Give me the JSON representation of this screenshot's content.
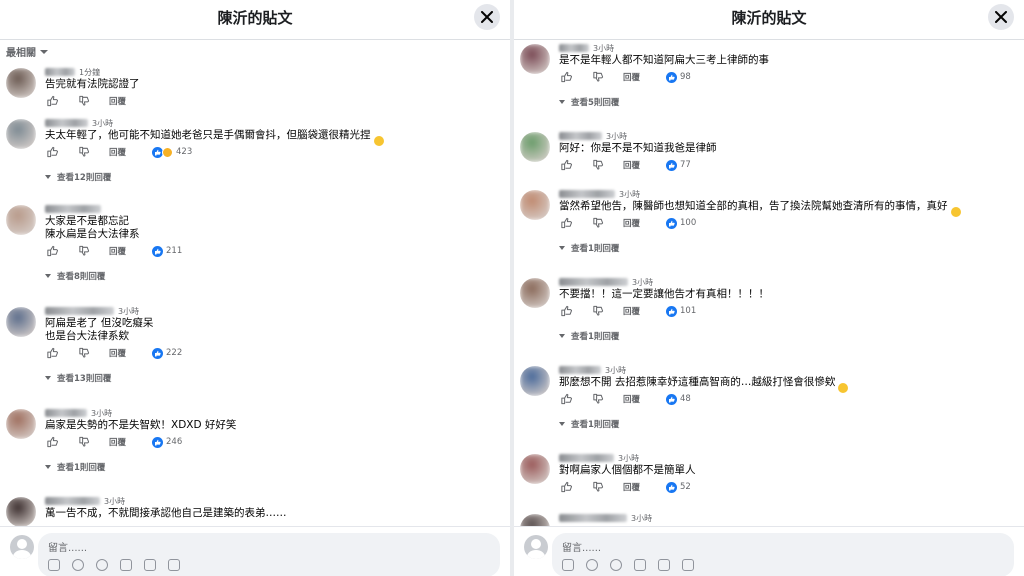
{
  "panels": [
    {
      "title": "陳沂的貼文",
      "sort_label": "最相關",
      "composer_placeholder": "留言......",
      "comments": [
        {
          "time": "1分鐘",
          "lines": [
            "告完就有法院認證了"
          ],
          "reply": "回覆",
          "count": "",
          "view_replies": "",
          "emoji": false
        },
        {
          "time": "3小時",
          "lines": [
            "夫太年輕了，他可能不知道她老爸只是手偶爾會抖，但腦袋還很精光捏"
          ],
          "reply": "回覆",
          "count": "423",
          "view_replies": "查看12則回覆",
          "emoji": true
        },
        {
          "time": "",
          "lines": [
            "大家是不是都忘記",
            "陳水扁是台大法律系"
          ],
          "reply": "回覆",
          "count": "211",
          "view_replies": "查看8則回覆",
          "emoji": false
        },
        {
          "time": "3小時",
          "lines": [
            "阿扁是老了 但沒吃癡呆",
            "也是台大法律系欸"
          ],
          "reply": "回覆",
          "count": "222",
          "view_replies": "查看13則回覆",
          "emoji": false
        },
        {
          "time": "3小時",
          "lines": [
            "扁家是失勢的不是失智欸！XDXD 好好笑"
          ],
          "reply": "回覆",
          "count": "246",
          "view_replies": "查看1則回覆",
          "emoji": false
        },
        {
          "time": "3小時",
          "lines": [
            "萬一告不成，不就間接承認他自己是建築的表弟……"
          ],
          "reply": "",
          "count": "",
          "view_replies": "",
          "emoji": false
        }
      ]
    },
    {
      "title": "陳沂的貼文",
      "composer_placeholder": "留言......",
      "comments": [
        {
          "time": "3小時",
          "lines": [
            "是不是年輕人都不知道阿扁大三考上律師的事"
          ],
          "reply": "回覆",
          "count": "98",
          "view_replies": "查看5則回覆",
          "emoji": false
        },
        {
          "time": "3小時",
          "lines": [
            "阿好：你是不是不知道我爸是律師"
          ],
          "reply": "回覆",
          "count": "77",
          "view_replies": "",
          "emoji": false
        },
        {
          "time": "3小時",
          "lines": [
            "當然希望他告，陳醫師也想知道全部的真相，告了換法院幫她查清所有的事情，真好"
          ],
          "reply": "回覆",
          "count": "100",
          "view_replies": "查看1則回覆",
          "emoji": true
        },
        {
          "time": "3小時",
          "lines": [
            "不要擋！！這一定要讓他告才有真相！！！！"
          ],
          "reply": "回覆",
          "count": "101",
          "view_replies": "查看1則回覆",
          "emoji": false
        },
        {
          "time": "3小時",
          "lines": [
            "那麼想不開 去招惹陳幸妤這種高智商的…越級打怪會很慘欸"
          ],
          "reply": "回覆",
          "count": "48",
          "view_replies": "查看1則回覆",
          "emoji": true
        },
        {
          "time": "3小時",
          "lines": [
            "對啊扁家人個個都不是簡單人"
          ],
          "reply": "回覆",
          "count": "52",
          "view_replies": "",
          "emoji": false
        },
        {
          "time": "3小時",
          "lines": [
            ""
          ],
          "reply": "",
          "count": "",
          "view_replies": "",
          "emoji": false
        }
      ]
    }
  ],
  "colors": {
    "accent": "#1877f2",
    "muted": "#65676b",
    "panel_bg": "#ffffff",
    "page_bg": "#e9ebee"
  },
  "icons": [
    "close-icon",
    "thumbs-up-icon",
    "thumbs-down-icon",
    "like-reaction-icon",
    "haha-reaction-icon",
    "caret-down-icon"
  ]
}
